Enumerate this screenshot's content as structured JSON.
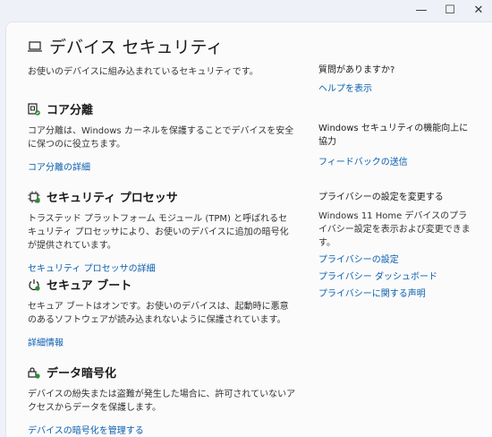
{
  "window": {
    "controls": {
      "minimize": "—",
      "maximize": "☐",
      "close": "✕"
    }
  },
  "page": {
    "title": "デバイス セキュリティ",
    "subtitle": "お使いのデバイスに組み込まれているセキュリティです。"
  },
  "sections": [
    {
      "title": "コア分離",
      "desc": "コア分離は、Windows カーネルを保護することでデバイスを安全に保つのに役立ちます。",
      "link": "コア分離の詳細",
      "icon": "core-isolation-icon"
    },
    {
      "title": "セキュリティ プロセッサ",
      "desc": "トラステッド プラットフォーム モジュール (TPM) と呼ばれるセキュリティ プロセッサにより、お使いのデバイスに追加の暗号化が提供されています。",
      "link": "セキュリティ プロセッサの詳細",
      "icon": "chip-icon"
    },
    {
      "title": "セキュア ブート",
      "desc": "セキュア ブートはオンです。お使いのデバイスは、起動時に悪意のあるソフトウェアが読み込まれないように保護されています。",
      "link": "詳細情報",
      "icon": "power-icon"
    },
    {
      "title": "データ暗号化",
      "desc": "デバイスの紛失または盗難が発生した場合に、許可されていないアクセスからデータを保護します。",
      "link": "デバイスの暗号化を管理する",
      "icon": "encryption-icon"
    }
  ],
  "sidebar": {
    "question": {
      "heading": "質問がありますか?",
      "link": "ヘルプを表示"
    },
    "feedback": {
      "heading": "Windows セキュリティの機能向上に協力",
      "link": "フィードバックの送信"
    },
    "privacy": {
      "heading": "プライバシーの設定を変更する",
      "desc": "Windows 11 Home デバイスのプライバシー設定を表示および変更できます。",
      "links": [
        "プライバシーの設定",
        "プライバシー ダッシュボード",
        "プライバシーに関する声明"
      ]
    }
  }
}
